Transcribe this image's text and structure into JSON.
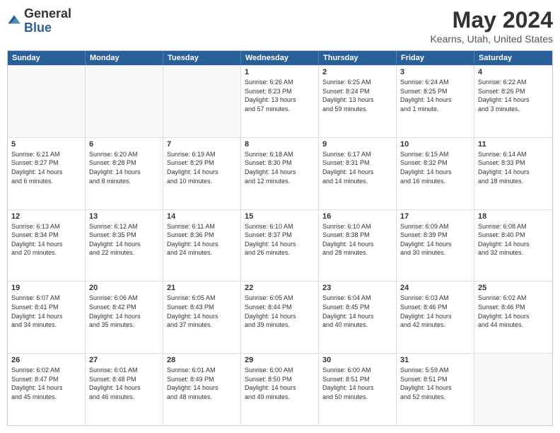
{
  "header": {
    "logo_general": "General",
    "logo_blue": "Blue",
    "title": "May 2024",
    "subtitle": "Kearns, Utah, United States"
  },
  "calendar": {
    "days": [
      "Sunday",
      "Monday",
      "Tuesday",
      "Wednesday",
      "Thursday",
      "Friday",
      "Saturday"
    ],
    "rows": [
      [
        {
          "num": "",
          "info": "",
          "empty": true
        },
        {
          "num": "",
          "info": "",
          "empty": true
        },
        {
          "num": "",
          "info": "",
          "empty": true
        },
        {
          "num": "1",
          "info": "Sunrise: 6:26 AM\nSunset: 8:23 PM\nDaylight: 13 hours\nand 57 minutes.",
          "empty": false
        },
        {
          "num": "2",
          "info": "Sunrise: 6:25 AM\nSunset: 8:24 PM\nDaylight: 13 hours\nand 59 minutes.",
          "empty": false
        },
        {
          "num": "3",
          "info": "Sunrise: 6:24 AM\nSunset: 8:25 PM\nDaylight: 14 hours\nand 1 minute.",
          "empty": false
        },
        {
          "num": "4",
          "info": "Sunrise: 6:22 AM\nSunset: 8:26 PM\nDaylight: 14 hours\nand 3 minutes.",
          "empty": false
        }
      ],
      [
        {
          "num": "5",
          "info": "Sunrise: 6:21 AM\nSunset: 8:27 PM\nDaylight: 14 hours\nand 6 minutes.",
          "empty": false
        },
        {
          "num": "6",
          "info": "Sunrise: 6:20 AM\nSunset: 8:28 PM\nDaylight: 14 hours\nand 8 minutes.",
          "empty": false
        },
        {
          "num": "7",
          "info": "Sunrise: 6:19 AM\nSunset: 8:29 PM\nDaylight: 14 hours\nand 10 minutes.",
          "empty": false
        },
        {
          "num": "8",
          "info": "Sunrise: 6:18 AM\nSunset: 8:30 PM\nDaylight: 14 hours\nand 12 minutes.",
          "empty": false
        },
        {
          "num": "9",
          "info": "Sunrise: 6:17 AM\nSunset: 8:31 PM\nDaylight: 14 hours\nand 14 minutes.",
          "empty": false
        },
        {
          "num": "10",
          "info": "Sunrise: 6:15 AM\nSunset: 8:32 PM\nDaylight: 14 hours\nand 16 minutes.",
          "empty": false
        },
        {
          "num": "11",
          "info": "Sunrise: 6:14 AM\nSunset: 8:33 PM\nDaylight: 14 hours\nand 18 minutes.",
          "empty": false
        }
      ],
      [
        {
          "num": "12",
          "info": "Sunrise: 6:13 AM\nSunset: 8:34 PM\nDaylight: 14 hours\nand 20 minutes.",
          "empty": false
        },
        {
          "num": "13",
          "info": "Sunrise: 6:12 AM\nSunset: 8:35 PM\nDaylight: 14 hours\nand 22 minutes.",
          "empty": false
        },
        {
          "num": "14",
          "info": "Sunrise: 6:11 AM\nSunset: 8:36 PM\nDaylight: 14 hours\nand 24 minutes.",
          "empty": false
        },
        {
          "num": "15",
          "info": "Sunrise: 6:10 AM\nSunset: 8:37 PM\nDaylight: 14 hours\nand 26 minutes.",
          "empty": false
        },
        {
          "num": "16",
          "info": "Sunrise: 6:10 AM\nSunset: 8:38 PM\nDaylight: 14 hours\nand 28 minutes.",
          "empty": false
        },
        {
          "num": "17",
          "info": "Sunrise: 6:09 AM\nSunset: 8:39 PM\nDaylight: 14 hours\nand 30 minutes.",
          "empty": false
        },
        {
          "num": "18",
          "info": "Sunrise: 6:08 AM\nSunset: 8:40 PM\nDaylight: 14 hours\nand 32 minutes.",
          "empty": false
        }
      ],
      [
        {
          "num": "19",
          "info": "Sunrise: 6:07 AM\nSunset: 8:41 PM\nDaylight: 14 hours\nand 34 minutes.",
          "empty": false
        },
        {
          "num": "20",
          "info": "Sunrise: 6:06 AM\nSunset: 8:42 PM\nDaylight: 14 hours\nand 35 minutes.",
          "empty": false
        },
        {
          "num": "21",
          "info": "Sunrise: 6:05 AM\nSunset: 8:43 PM\nDaylight: 14 hours\nand 37 minutes.",
          "empty": false
        },
        {
          "num": "22",
          "info": "Sunrise: 6:05 AM\nSunset: 8:44 PM\nDaylight: 14 hours\nand 39 minutes.",
          "empty": false
        },
        {
          "num": "23",
          "info": "Sunrise: 6:04 AM\nSunset: 8:45 PM\nDaylight: 14 hours\nand 40 minutes.",
          "empty": false
        },
        {
          "num": "24",
          "info": "Sunrise: 6:03 AM\nSunset: 8:46 PM\nDaylight: 14 hours\nand 42 minutes.",
          "empty": false
        },
        {
          "num": "25",
          "info": "Sunrise: 6:02 AM\nSunset: 8:46 PM\nDaylight: 14 hours\nand 44 minutes.",
          "empty": false
        }
      ],
      [
        {
          "num": "26",
          "info": "Sunrise: 6:02 AM\nSunset: 8:47 PM\nDaylight: 14 hours\nand 45 minutes.",
          "empty": false
        },
        {
          "num": "27",
          "info": "Sunrise: 6:01 AM\nSunset: 8:48 PM\nDaylight: 14 hours\nand 46 minutes.",
          "empty": false
        },
        {
          "num": "28",
          "info": "Sunrise: 6:01 AM\nSunset: 8:49 PM\nDaylight: 14 hours\nand 48 minutes.",
          "empty": false
        },
        {
          "num": "29",
          "info": "Sunrise: 6:00 AM\nSunset: 8:50 PM\nDaylight: 14 hours\nand 49 minutes.",
          "empty": false
        },
        {
          "num": "30",
          "info": "Sunrise: 6:00 AM\nSunset: 8:51 PM\nDaylight: 14 hours\nand 50 minutes.",
          "empty": false
        },
        {
          "num": "31",
          "info": "Sunrise: 5:59 AM\nSunset: 8:51 PM\nDaylight: 14 hours\nand 52 minutes.",
          "empty": false
        },
        {
          "num": "",
          "info": "",
          "empty": true
        }
      ]
    ]
  }
}
